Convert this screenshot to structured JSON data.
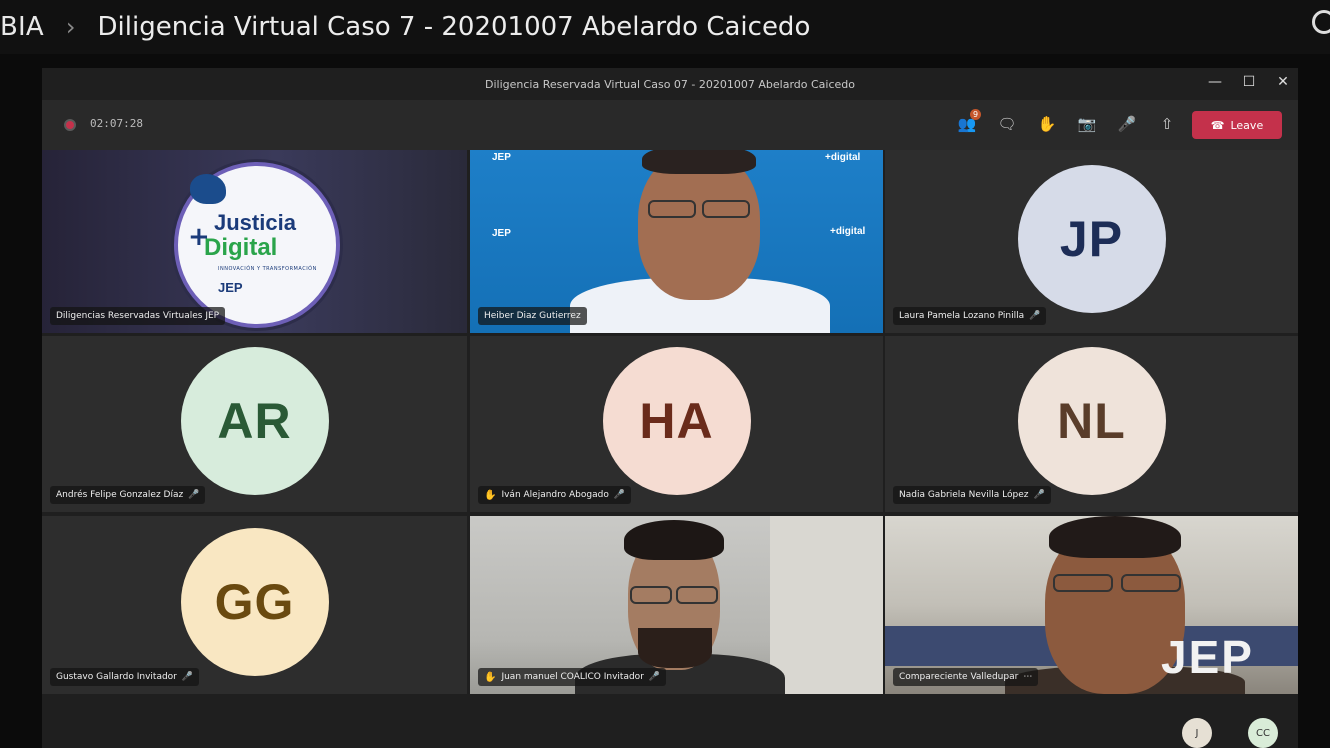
{
  "outer": {
    "crumb": "BIA",
    "separator": "›",
    "title": "Diligencia Virtual Caso 7 - 20201007 Abelardo Caicedo"
  },
  "window": {
    "title": "Diligencia Reservada Virtual Caso 07 - 20201007 Abelardo Caicedo",
    "minimize": "—",
    "maximize": "☐",
    "close": "✕"
  },
  "toolbar": {
    "timer": "02:07:28",
    "participants_badge": "9",
    "leave_label": "Leave"
  },
  "tiles": [
    {
      "name": "Diligencias Reservadas Virtuales JEP",
      "type": "logo"
    },
    {
      "name": "Heiber Diaz Gutierrez",
      "type": "video"
    },
    {
      "name": "Laura Pamela Lozano Pinilla",
      "initials": "JP",
      "bg": "#d6dbe8",
      "fg": "#1d2d57"
    },
    {
      "name": "Andrés Felipe Gonzalez Díaz",
      "initials": "AR",
      "bg": "#d7ecdc",
      "fg": "#2a5a36"
    },
    {
      "name": "Iván Alejandro Abogado",
      "initials": "HA",
      "bg": "#f5dcd2",
      "fg": "#6a2b1b"
    },
    {
      "name": "Nadia Gabriela Nevilla López",
      "initials": "NL",
      "bg": "#efe3da",
      "fg": "#5a3d2a"
    },
    {
      "name": "Gustavo Gallardo Invitador",
      "initials": "GG",
      "bg": "#f9e7c2",
      "fg": "#6a4a10"
    },
    {
      "name": "Juan manuel COALICO Invitador",
      "type": "video"
    },
    {
      "name": "Compareciente Valledupar",
      "type": "video"
    }
  ],
  "logo": {
    "line1": "Justicia",
    "plus": "+",
    "line2": "Digital",
    "sub": "INNOVACIÓN Y TRANSFORMACIÓN",
    "jep": "JEP"
  },
  "watermark": "JEP",
  "mini_avatars": [
    "J",
    "CC"
  ]
}
